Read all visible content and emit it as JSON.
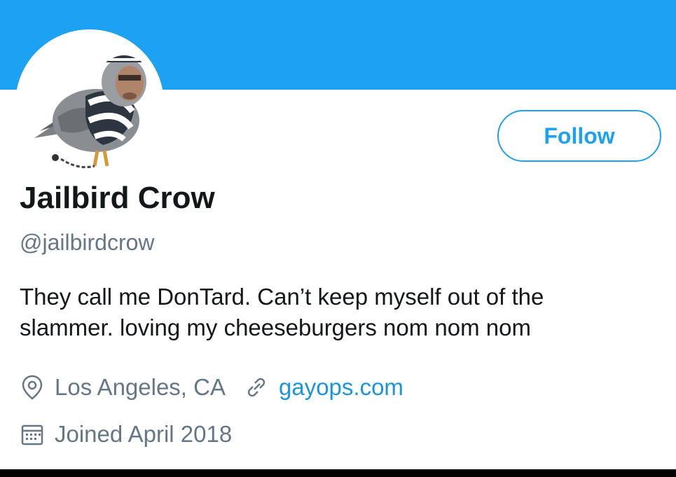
{
  "profile": {
    "display_name": "Jailbird Crow",
    "handle": "@jailbirdcrow",
    "bio_lines": [
      "They call me DonTard. Can’t keep myself out of the",
      "slammer. loving my cheeseburgers nom nom nom"
    ],
    "location": "Los Angeles, CA",
    "website": "gayops.com",
    "joined": "Joined April 2018"
  },
  "actions": {
    "follow_label": "Follow"
  },
  "icons": {
    "avatar": "pigeon-avatar-icon",
    "location": "location-pin-icon",
    "website": "link-icon",
    "joined": "calendar-icon"
  },
  "colors": {
    "banner": "#1da1f2",
    "accent": "#1da1f2",
    "link": "#1b95e0",
    "text_primary": "#14171a",
    "text_secondary": "#657786"
  }
}
